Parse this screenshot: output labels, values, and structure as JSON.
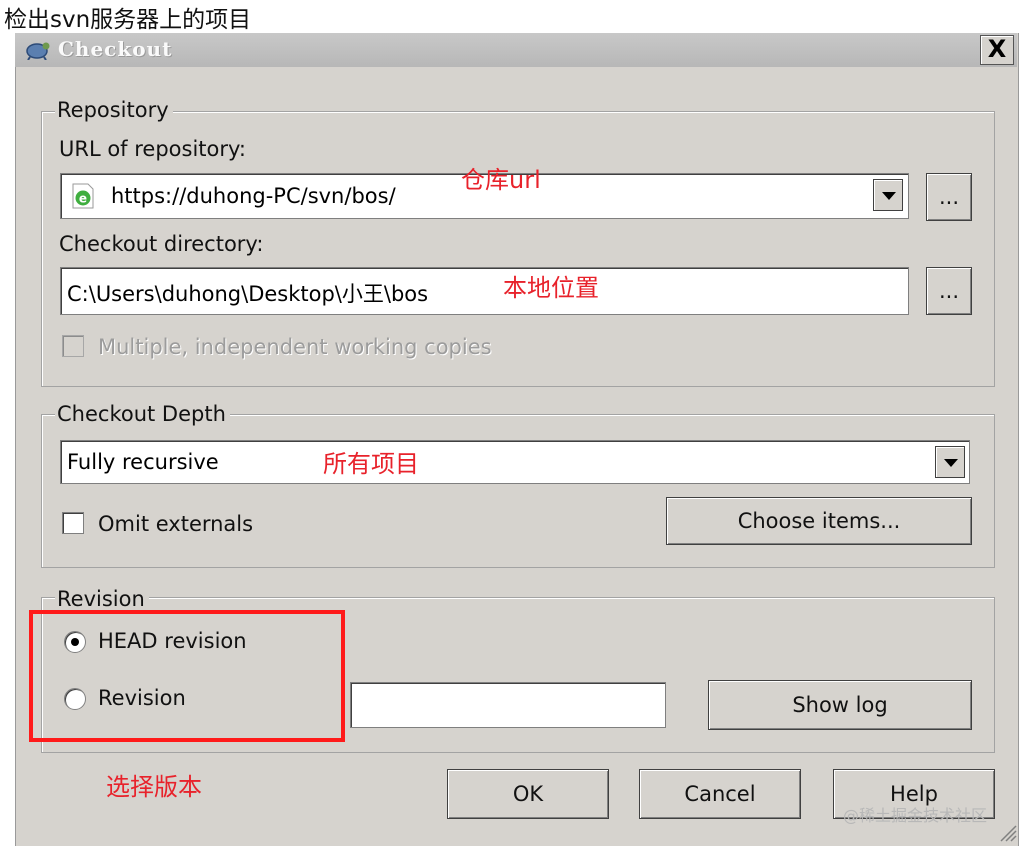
{
  "caption": "检出svn服务器上的项目",
  "window": {
    "title": "Checkout",
    "close_label": "X",
    "title_icon": "tortoise-svn-icon"
  },
  "repository": {
    "legend": "Repository",
    "url_label": "URL of repository:",
    "url_value": "https://duhong-PC/svn/bos/",
    "url_icon": "ie-page-icon",
    "browse_label": "...",
    "dir_label": "Checkout directory:",
    "dir_value": "C:\\Users\\duhong\\Desktop\\小王\\bos",
    "multiple_label": "Multiple, independent working copies"
  },
  "depth": {
    "legend": "Checkout Depth",
    "selected": "Fully recursive",
    "omit_label": "Omit externals",
    "choose_label": "Choose items..."
  },
  "revision": {
    "legend": "Revision",
    "head_label": "HEAD revision",
    "revision_label": "Revision",
    "revision_value": "",
    "show_log_label": "Show log",
    "selected": "HEAD revision"
  },
  "buttons": {
    "ok": "OK",
    "cancel": "Cancel",
    "help": "Help"
  },
  "annotations": {
    "repo_url": "仓库url",
    "local": "本地位置",
    "all_items": "所有项目",
    "select_version": "选择版本",
    "color": "#e8222b"
  },
  "watermark": "@稀土掘金技术社区"
}
